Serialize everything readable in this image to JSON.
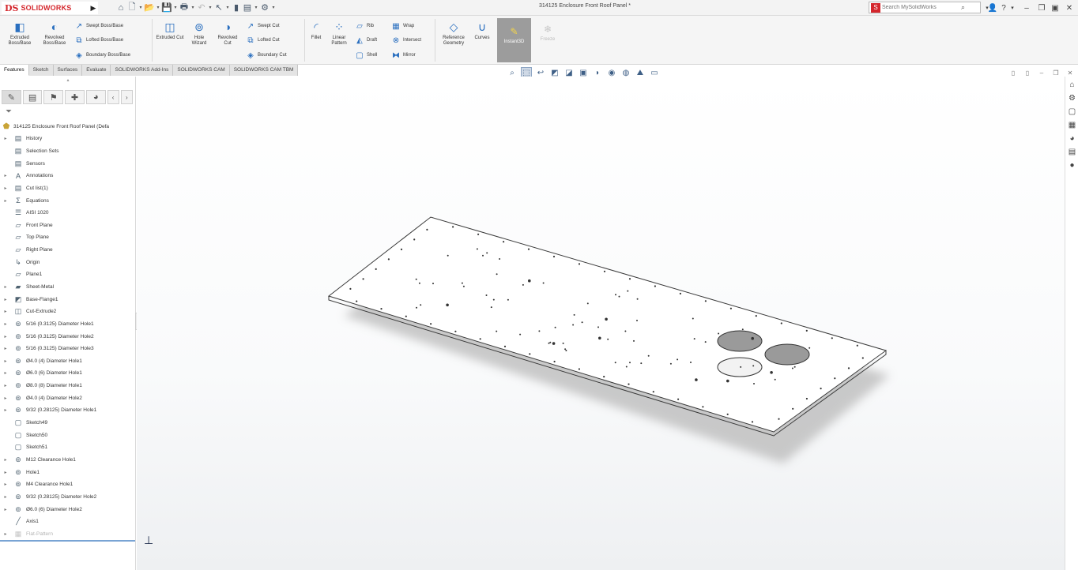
{
  "app": {
    "brand_prefix": "DS",
    "brand_name": "SOLIDWORKS",
    "document_title": "314125 Enclosure Front Roof Panel *",
    "search_placeholder": "Search MySolidWorks"
  },
  "ribbon": {
    "extruded_boss": "Extruded Boss/Base",
    "revolved_boss": "Revolved Boss/Base",
    "swept_boss": "Swept Boss/Base",
    "lofted_boss": "Lofted Boss/Base",
    "boundary_boss": "Boundary Boss/Base",
    "extruded_cut": "Extruded Cut",
    "hole_wizard": "Hole Wizard",
    "revolved_cut": "Revolved Cut",
    "swept_cut": "Swept Cut",
    "lofted_cut": "Lofted Cut",
    "boundary_cut": "Boundary Cut",
    "fillet": "Fillet",
    "linear_pattern": "Linear Pattern",
    "rib": "Rib",
    "draft": "Draft",
    "shell": "Shell",
    "wrap": "Wrap",
    "intersect": "Intersect",
    "mirror": "Mirror",
    "reference_geometry": "Reference Geometry",
    "curves": "Curves",
    "instant3d": "Instant3D",
    "freeze": "Freeze"
  },
  "command_tabs": [
    "Features",
    "Sketch",
    "Surfaces",
    "Evaluate",
    "SOLIDWORKS Add-Ins",
    "SOLIDWORKS CAM",
    "SOLIDWORKS CAM TBM"
  ],
  "tree": {
    "root_label": "314125 Enclosure Front Roof Panel  (Defa",
    "items": [
      {
        "label": "History",
        "expand": true,
        "icon": "history-icon"
      },
      {
        "label": "Selection Sets",
        "expand": false,
        "icon": "selection-sets-icon"
      },
      {
        "label": "Sensors",
        "expand": false,
        "icon": "sensors-icon"
      },
      {
        "label": "Annotations",
        "expand": true,
        "icon": "annotations-icon"
      },
      {
        "label": "Cut list(1)",
        "expand": true,
        "icon": "cut-list-icon"
      },
      {
        "label": "Equations",
        "expand": true,
        "icon": "equations-icon"
      },
      {
        "label": "AISI 1020",
        "expand": false,
        "icon": "material-icon"
      },
      {
        "label": "Front Plane",
        "expand": false,
        "icon": "plane-icon"
      },
      {
        "label": "Top Plane",
        "expand": false,
        "icon": "plane-icon"
      },
      {
        "label": "Right Plane",
        "expand": false,
        "icon": "plane-icon"
      },
      {
        "label": "Origin",
        "expand": false,
        "icon": "origin-icon"
      },
      {
        "label": "Plane1",
        "expand": false,
        "icon": "plane-icon"
      },
      {
        "label": "Sheet-Metal",
        "expand": true,
        "icon": "sheet-metal-icon"
      },
      {
        "label": "Base-Flange1",
        "expand": true,
        "icon": "base-flange-icon"
      },
      {
        "label": "Cut-Extrude2",
        "expand": true,
        "icon": "cut-extrude-icon"
      },
      {
        "label": "5/16 (0.3125) Diameter Hole1",
        "expand": true,
        "icon": "hole-icon"
      },
      {
        "label": "5/16 (0.3125) Diameter Hole2",
        "expand": true,
        "icon": "hole-icon"
      },
      {
        "label": "5/16 (0.3125) Diameter Hole3",
        "expand": true,
        "icon": "hole-icon"
      },
      {
        "label": "Ø4.0 (4) Diameter Hole1",
        "expand": true,
        "icon": "hole-icon"
      },
      {
        "label": "Ø6.0 (6) Diameter Hole1",
        "expand": true,
        "icon": "hole-icon"
      },
      {
        "label": "Ø8.0 (8) Diameter Hole1",
        "expand": true,
        "icon": "hole-icon"
      },
      {
        "label": "Ø4.0 (4) Diameter Hole2",
        "expand": true,
        "icon": "hole-icon"
      },
      {
        "label": "9/32 (0.28125) Diameter Hole1",
        "expand": true,
        "icon": "hole-icon"
      },
      {
        "label": "Sketch49",
        "expand": false,
        "icon": "sketch-icon"
      },
      {
        "label": "Sketch50",
        "expand": false,
        "icon": "sketch-icon"
      },
      {
        "label": "Sketch51",
        "expand": false,
        "icon": "sketch-icon"
      },
      {
        "label": "M12 Clearance Hole1",
        "expand": true,
        "icon": "hole-icon"
      },
      {
        "label": "Hole1",
        "expand": true,
        "icon": "hole-icon"
      },
      {
        "label": "M4 Clearance Hole1",
        "expand": true,
        "icon": "hole-icon"
      },
      {
        "label": "9/32 (0.28125) Diameter Hole2",
        "expand": true,
        "icon": "hole-icon"
      },
      {
        "label": "Ø6.0 (6) Diameter Hole2",
        "expand": true,
        "icon": "hole-icon"
      },
      {
        "label": "Axis1",
        "expand": false,
        "icon": "axis-icon"
      },
      {
        "label": "Flat-Pattern",
        "expand": true,
        "icon": "flat-pattern-icon",
        "faded": true
      }
    ]
  }
}
